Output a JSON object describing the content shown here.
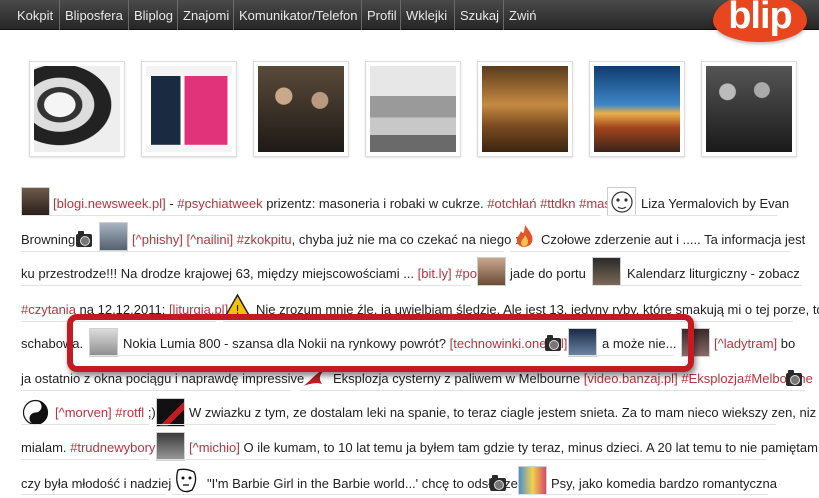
{
  "nav": {
    "items": [
      "Kokpit",
      "Bliposfera",
      "Bliplog",
      "Znajomi",
      "Komunikator/Telefon",
      "Profil",
      "Wklejki",
      "Szukaj",
      "Zwiń"
    ]
  },
  "logo": {
    "text": "blip"
  },
  "colors": {
    "accent": "#e8461e",
    "tag": "#b5343f",
    "highlight": "#c41a22",
    "navbar": "#2e2e2e"
  },
  "stream": {
    "line1": {
      "tag_newsweek": "[blogi.newsweek.pl]",
      "sep": " - ",
      "tag_psychiatweek": "#psychiatweek",
      "text": " prizentz: masoneria i robaki w cukrze. ",
      "tag_otchlan": "#otchłań",
      "tag_ttdkn": "#ttdkn",
      "tag_masoni": "#masoni",
      "text2": "Liza Yermalovich by Evan"
    },
    "line2": {
      "text1": "Browning",
      "tag_phishy": "[^phishy]",
      "tag_nailini": "[^nailini]",
      "tag_zkokpitu": "#zkokpitu",
      "text2": ", chyba już nie ma co czekać na niego :P",
      "text3": "Czołowe zderzenie aut i ..... Ta informacja jest"
    },
    "line3": {
      "text1": "ku przestrodze!!! Na drodze krajowej 63, między miejscowościami ...",
      "tag_bitly": "[bit.ly]",
      "tag_policja": "#policja",
      "text2": "jade do portu",
      "text3": "Kalendarz liturgiczny - zobacz"
    },
    "line4": {
      "tag_czytania": "#czytania",
      "text1": " na 12.12.2011: ",
      "tag_liturgia": "[liturgia.pl]",
      "text2": "Nie zrozum mnie źle, ja uwielbiam śledzie. Ale jest 13, jedyny ryby, które smakują mi o tej porze, to"
    },
    "line5": {
      "text1": "schabowa.",
      "text2": "Nokia Lumia 800 - szansa dla Nokii na rynkowy powrót?",
      "tag_technowinki": "[technowinki.onet.pl]",
      "text3": "a może nie...",
      "tag_ladytram": "[^ladytram]",
      "text4": " bo"
    },
    "line6": {
      "text1": "ja ostatnio z okna pociągu i naprawdę impressive",
      "text2": "Eksplozja cysterny z paliwem w Melbourne",
      "tag_banzaj": "[video.banzaj.pl]",
      "tag_eksplozja": "#Eksplozja",
      "tag_melbourne": "#Melbourne"
    },
    "line7": {
      "tag_morven": "[^morven]",
      "tag_rotfl": "#rotfl",
      "text1": " ;)",
      "text2": "W zwiazku z tym, ze dostalam leki na spanie, to teraz ciagle jestem snieta. Za to mam nieco wiekszy zen, niz"
    },
    "line8": {
      "text1": "mialam.",
      "tag_trudnewybory": "#trudnewybory",
      "tag_michio": "[^michio]",
      "text2": " O ile kumam, to 10 lat temu ja byłem tam gdzie ty teraz, minus dzieci. A 20 lat temu to nie pamiętam,"
    },
    "line9": {
      "text1": "czy była młodość i nadzieja",
      "text2": "\"I'm Barbie Girl in the Barbie world...' chcę to odsłyszeć.",
      "text3": "Psy, jako komedia bardzo romantyczna"
    }
  }
}
